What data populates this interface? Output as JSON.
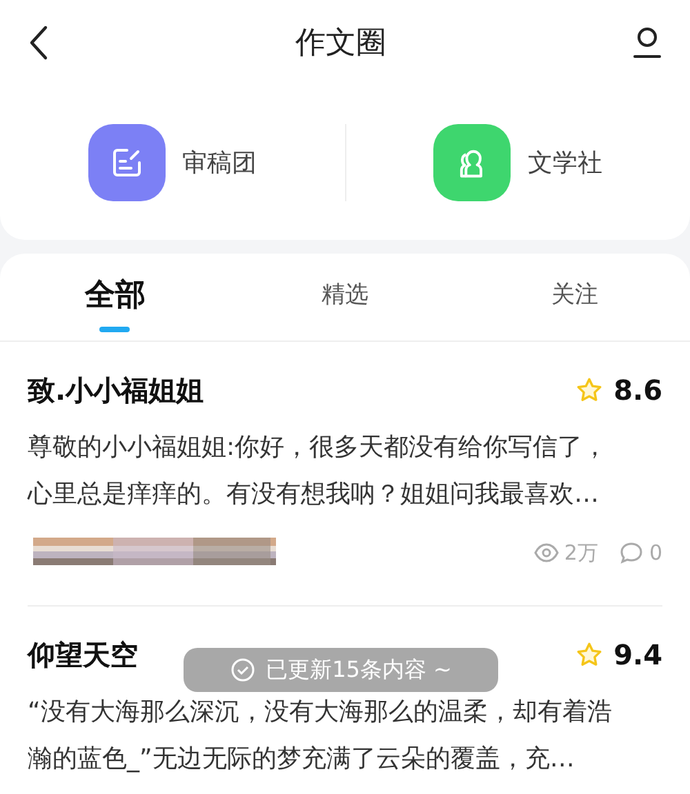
{
  "header": {
    "title": "作文圈"
  },
  "shortcuts": [
    {
      "kind": "review",
      "label": "审稿团",
      "color": "#7c80f5"
    },
    {
      "kind": "club",
      "label": "文学社",
      "color": "#3ed66e"
    }
  ],
  "tabs": [
    {
      "label": "全部",
      "selected": true
    },
    {
      "label": "精选",
      "selected": false
    },
    {
      "label": "关注",
      "selected": false
    }
  ],
  "posts": [
    {
      "title": "致.小小福姐姐",
      "score": "8.6",
      "excerpt": "尊敬的小小福姐姐:你好，很多天都没有给你写信了，心里总是痒痒的。有没有想我呐？姐姐问我最喜欢…",
      "views": "2万",
      "comments": "0"
    },
    {
      "title": "仰望天空",
      "score": "9.4",
      "excerpt": "“没有大海那么深沉，没有大海那么的温柔，却有着浩瀚的蓝色_”无边无际的梦充满了云朵的覆盖，充…"
    }
  ],
  "toast": {
    "text": "已更新15条内容 ~"
  }
}
